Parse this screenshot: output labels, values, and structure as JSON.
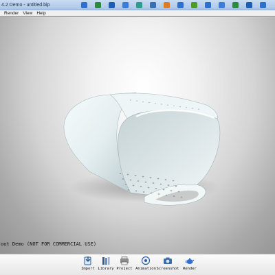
{
  "window": {
    "title": "4.2 Demo - untitled.bip"
  },
  "toolbar_icons": [
    {
      "icon": "toolbar-icon-1",
      "color": "#2f6fd0"
    },
    {
      "icon": "toolbar-icon-2",
      "color": "#2b8a3e"
    },
    {
      "icon": "toolbar-icon-3",
      "color": "#1d5fb8"
    },
    {
      "icon": "toolbar-icon-4",
      "color": "#3d7bd9"
    },
    {
      "icon": "toolbar-icon-5",
      "color": "#2a9d8f"
    },
    {
      "icon": "toolbar-icon-6",
      "color": "#3a6fb0"
    },
    {
      "icon": "toolbar-icon-7",
      "color": "#e07b22"
    },
    {
      "icon": "toolbar-icon-8",
      "color": "#2f6fd0"
    },
    {
      "icon": "toolbar-icon-9",
      "color": "#4c9a2a"
    },
    {
      "icon": "toolbar-icon-10",
      "color": "#2f6fd0"
    },
    {
      "icon": "toolbar-icon-11",
      "color": "#3b7dd8"
    },
    {
      "icon": "toolbar-icon-12",
      "color": "#2b8a3e"
    },
    {
      "icon": "toolbar-icon-13",
      "color": "#1d5fb8"
    },
    {
      "icon": "toolbar-icon-14",
      "color": "#2f6fd0"
    }
  ],
  "menu": {
    "render": "Render",
    "view": "View",
    "help": "Help"
  },
  "viewport": {
    "watermark": "oot Demo (NOT FOR COMMERCIAL USE)"
  },
  "bottom_toolbar": {
    "import": "Import",
    "library": "Library",
    "project": "Project",
    "animation": "Animation",
    "screenshot": "Screenshot",
    "render": "Render"
  }
}
